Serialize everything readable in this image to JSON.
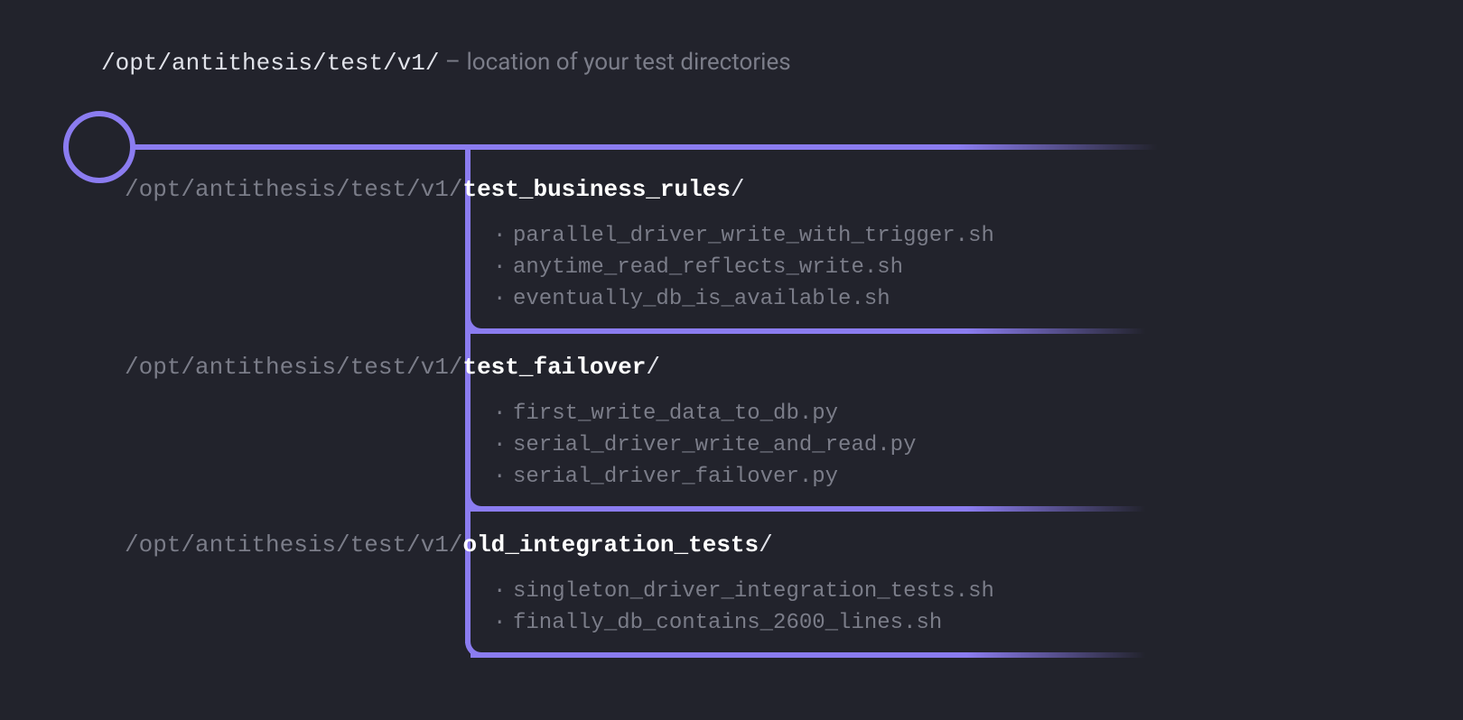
{
  "header": {
    "path": "/opt/antithesis/test/v1/",
    "dash": " – ",
    "description": "location of your test directories"
  },
  "path_prefix": "/opt/antithesis/test/v1/",
  "colors": {
    "background": "#22232c",
    "accent": "#8b7cf0",
    "text_light": "#e0e2e9",
    "text_dim": "#7b7d89",
    "text_bright": "#ffffff"
  },
  "directories": [
    {
      "name": "test_business_rules",
      "files": [
        "parallel_driver_write_with_trigger.sh",
        "anytime_read_reflects_write.sh",
        "eventually_db_is_available.sh"
      ]
    },
    {
      "name": "test_failover",
      "files": [
        "first_write_data_to_db.py",
        "serial_driver_write_and_read.py",
        "serial_driver_failover.py"
      ]
    },
    {
      "name": "old_integration_tests",
      "files": [
        "singleton_driver_integration_tests.sh",
        "finally_db_contains_2600_lines.sh"
      ]
    }
  ]
}
